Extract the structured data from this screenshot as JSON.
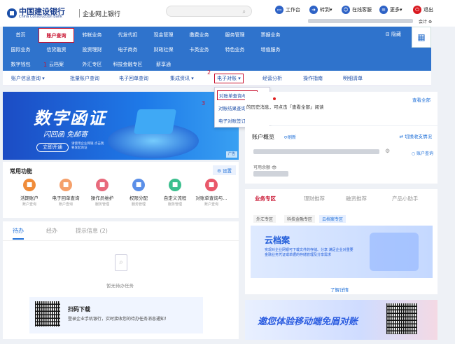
{
  "header": {
    "bank_cn": "中国建设银行",
    "bank_en": "China Construction Bank",
    "system": "企业网上银行",
    "nav": [
      {
        "icon": "desk-icon",
        "label": "工作台"
      },
      {
        "icon": "transfer-icon",
        "label": "转到▾"
      },
      {
        "icon": "service-icon",
        "label": "在线客服"
      },
      {
        "icon": "more-icon",
        "label": "更多▾"
      },
      {
        "icon": "power-icon",
        "label": "退出"
      }
    ],
    "status": "会计 ⚙"
  },
  "menu": {
    "row1": [
      "首页",
      "账户查询",
      "转帐业务",
      "代发代扣",
      "现金管理",
      "缴费业务",
      "服务管理",
      "票据业务"
    ],
    "row2": [
      "国际业务",
      "信贷融资",
      "投资理财",
      "电子商务",
      "财政社保",
      "卡类业务",
      "特色业务",
      "增值服务"
    ],
    "row3": [
      "数字钱包",
      "云档案",
      "外汇专区",
      "科技金融专区",
      "薪享通"
    ],
    "pin": "⊟ 隐藏"
  },
  "submenu": [
    "账户信息查询 ▾",
    "批量账户查询",
    "电子回单查询",
    "集成资讯 ▾",
    "电子对账 ▾",
    "经营分析",
    "操作指南",
    "明细清单"
  ],
  "markers": [
    "1",
    "2",
    "3"
  ],
  "dropdown": [
    "对账单查询与回签",
    "对账结果查询",
    "电子对账签订管理 ▸"
  ],
  "banner": {
    "title": "数字函证",
    "subtitle": "闪回函 免邮寄",
    "button": "立即开通",
    "note": "请使用企业网银 点击我要发起询证",
    "tag": "广告"
  },
  "notice": {
    "text": "的历史消息，可点击「查看全部」阅读",
    "link": "查看全部"
  },
  "account": {
    "title": "账户概览",
    "refresh": "⟳刷新",
    "switch": "⇄ 切换收支情况",
    "balance_label": "可用余额 👁",
    "acct_link": "○ 账户查询"
  },
  "common": {
    "title": "常用功能",
    "setting": "⚙ 设置",
    "items": [
      {
        "label": "活期账户",
        "sub": "账户查询",
        "color": "#f08c3a"
      },
      {
        "label": "电子回单查询",
        "sub": "账户查询",
        "color": "#f5a06a"
      },
      {
        "label": "操作员维护",
        "sub": "服务管理",
        "color": "#e86a7c"
      },
      {
        "label": "权限分配",
        "sub": "服务管理",
        "color": "#5b8fe8"
      },
      {
        "label": "自定义流程",
        "sub": "服务管理",
        "color": "#3bbf8e"
      },
      {
        "label": "对账单查询与...",
        "sub": "账户查询",
        "color": "#e9586a"
      }
    ]
  },
  "todo": {
    "tabs": [
      "待办",
      "经办",
      "提示信息 (2)"
    ],
    "empty": "暂无待办任务",
    "download_title": "扫码下载",
    "download_text": "登录企业手机银行，实时接收您的待办任务消息通知！"
  },
  "service": {
    "tabs": [
      "业务专区",
      "理财推荐",
      "融资推荐",
      "产品小助手"
    ],
    "chips": [
      "外汇专区",
      "科技金融专区",
      "云档案专区"
    ],
    "card_title": "云档案",
    "card_text": "实现对企业网银可下载文件的存储、分享 满足企业对重要金融业务凭证或单据的存储管理及分享需求",
    "more": "了解详情"
  },
  "promo": {
    "text": "邀您体验移动端免眉对账"
  }
}
